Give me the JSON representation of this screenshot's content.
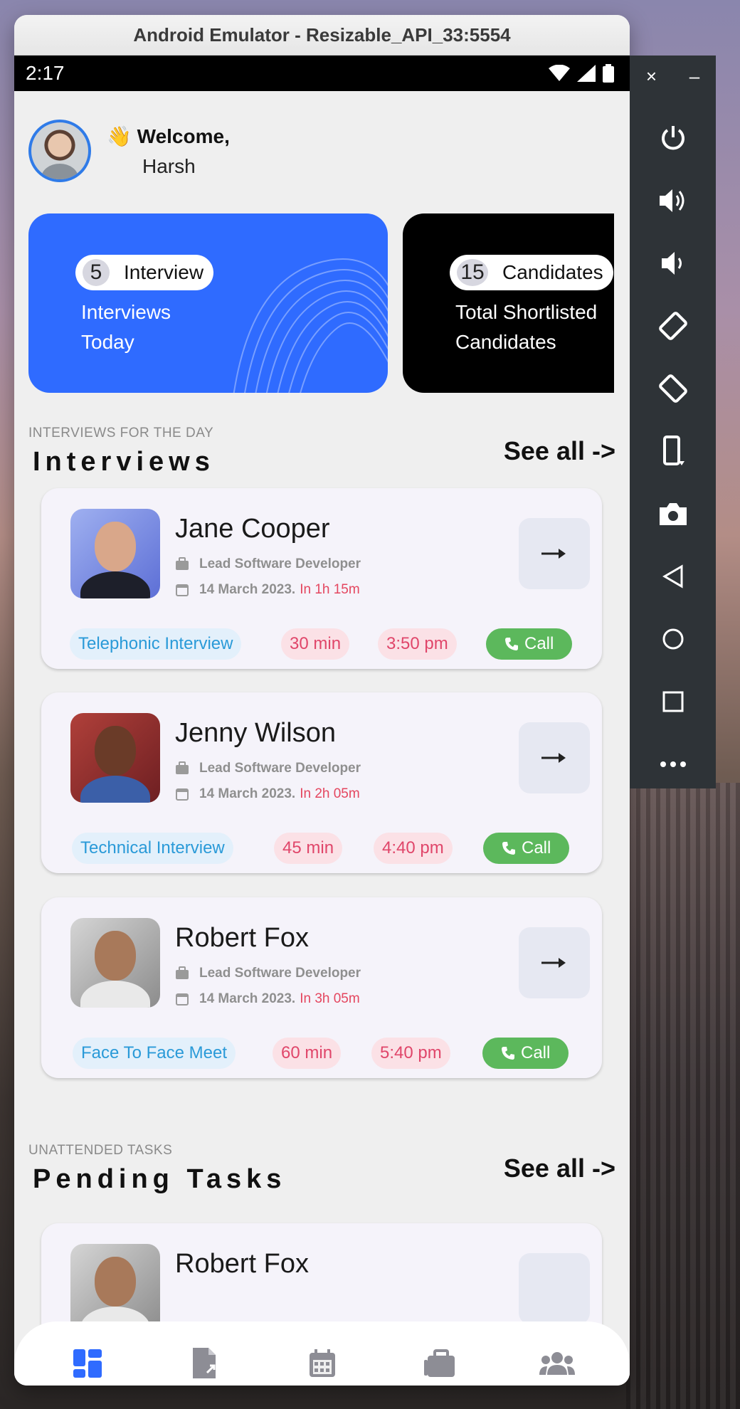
{
  "window": {
    "title": "Android Emulator - Resizable_API_33:5554"
  },
  "status_bar": {
    "time": "2:17"
  },
  "header": {
    "wave": "👋",
    "greeting": "Welcome,",
    "user_name": "Harsh"
  },
  "stats": [
    {
      "count": "5",
      "tag": "Interview",
      "description_line1": "Interviews",
      "description_line2": "Today",
      "color": "#2f6bff"
    },
    {
      "count": "15",
      "tag": "Candidates",
      "description_line1": "Total Shortlisted",
      "description_line2": "Candidates",
      "color": "#000000"
    }
  ],
  "interviews_section": {
    "label": "INTERVIEWS FOR THE DAY",
    "title": "Interviews",
    "see_all": "See all ->"
  },
  "interviews": [
    {
      "name": "Jane Cooper",
      "role": "Lead Software Developer",
      "date": "14 March 2023.",
      "due": "In 1h 15m",
      "type": "Telephonic Interview",
      "duration": "30 min",
      "time": "3:50 pm",
      "call": "Call"
    },
    {
      "name": "Jenny Wilson",
      "role": "Lead Software Developer",
      "date": "14 March 2023.",
      "due": "In 2h 05m",
      "type": "Technical Interview",
      "duration": "45 min",
      "time": "4:40 pm",
      "call": "Call"
    },
    {
      "name": "Robert Fox",
      "role": "Lead Software Developer",
      "date": "14 March 2023.",
      "due": "In 3h 05m",
      "type": "Face To Face Meet",
      "duration": "60 min",
      "time": "5:40 pm",
      "call": "Call"
    }
  ],
  "pending_section": {
    "label": "UNATTENDED TASKS",
    "title": "Pending Tasks",
    "see_all": "See all ->"
  },
  "pending_tasks": [
    {
      "name": "Robert Fox"
    }
  ],
  "bottom_nav": [
    "dashboard-icon",
    "document-icon",
    "calendar-icon",
    "briefcase-icon",
    "people-icon"
  ],
  "side_panel": {
    "close": "×",
    "minimize": "–"
  },
  "colors": {
    "accent": "#2f6bff",
    "call_green": "#5cb85c",
    "due_red": "#e4465f",
    "tag_blue": "#2a9ad8"
  }
}
